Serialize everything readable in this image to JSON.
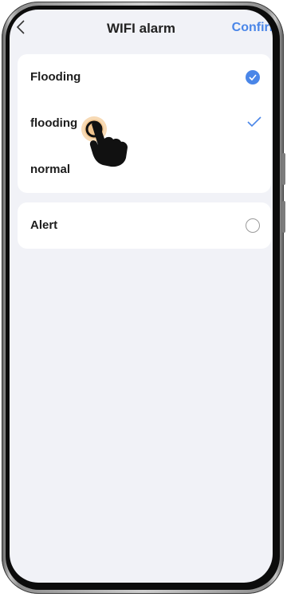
{
  "header": {
    "title": "WIFI alarm",
    "confirm_label": "Confirm"
  },
  "options_group": {
    "items": [
      {
        "label": "Flooding",
        "state": "selected"
      },
      {
        "label": "flooding",
        "state": "checked"
      },
      {
        "label": "normal",
        "state": "none"
      }
    ]
  },
  "alert_group": {
    "label": "Alert",
    "state": "unselected"
  },
  "colors": {
    "accent": "#4a86e8",
    "background": "#f1f2f7",
    "card": "#ffffff"
  },
  "icons": [
    "back-chevron-icon",
    "check-circle-icon",
    "check-icon",
    "radio-empty-icon",
    "tap-hand-icon"
  ]
}
